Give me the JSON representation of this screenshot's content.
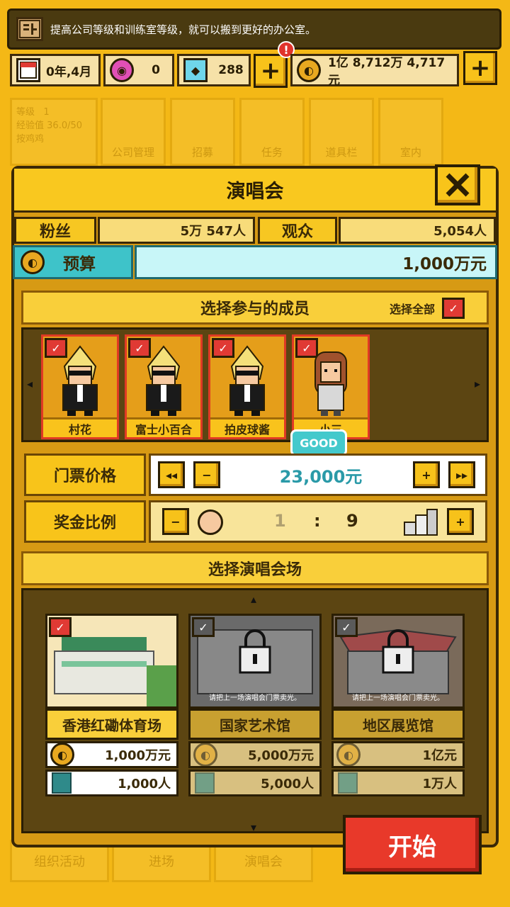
{
  "tip": {
    "icon_label": "",
    "text": "提高公司等级和训练室等级，就可以搬到更好的办公室。"
  },
  "resources": {
    "date": "0年,4月",
    "gems": "0",
    "diamonds": "288",
    "money": "1亿 8,712万 4,717元",
    "alert": "!"
  },
  "background_menu": {
    "level_label": "等级",
    "level_value": "1",
    "exp_label": "经验值",
    "exp_value": "36.0/50",
    "extra": "按鸡鸡",
    "tiles": [
      "公司管理",
      "招募",
      "任务",
      "道具栏",
      "室内"
    ],
    "bottom": [
      "组织活动",
      "进场",
      "演唱会"
    ]
  },
  "dialog": {
    "title": "演唱会",
    "fans_label": "粉丝",
    "fans_value": "5万 547人",
    "audience_label": "观众",
    "audience_value": "5,054人",
    "budget_label": "预算",
    "budget_value": "1,000万元",
    "select_members": "选择参与的成员",
    "select_all": "选择全部",
    "members": [
      {
        "name": "村花",
        "type": "blonde"
      },
      {
        "name": "富士小百合",
        "type": "blonde"
      },
      {
        "name": "拍皮球酱",
        "type": "blonde"
      },
      {
        "name": "小三",
        "type": "brunette"
      }
    ],
    "good_badge": "GOOD",
    "ticket_label": "门票价格",
    "ticket_value": "23,000元",
    "bonus_label": "奖金比例",
    "bonus_left": "1",
    "bonus_sep": ":",
    "bonus_right": "9",
    "select_venue": "选择演唱会场",
    "venues": [
      {
        "name": "香港红磡体育场",
        "cost": "1,000万元",
        "capacity": "1,000人",
        "locked": false,
        "note": ""
      },
      {
        "name": "国家艺术馆",
        "cost": "5,000万元",
        "capacity": "5,000人",
        "locked": true,
        "note": "请把上一场演唱会门票卖光。"
      },
      {
        "name": "地区展览馆",
        "cost": "1亿元",
        "capacity": "1万人",
        "locked": true,
        "note": "请把上一场演唱会门票卖光。"
      }
    ],
    "start_button": "开始"
  },
  "colors": {
    "accent": "#f9c81f",
    "budget": "#3ec3c9",
    "good": "#44c9cc",
    "start": "#e8392a",
    "check": "#e03a34"
  }
}
